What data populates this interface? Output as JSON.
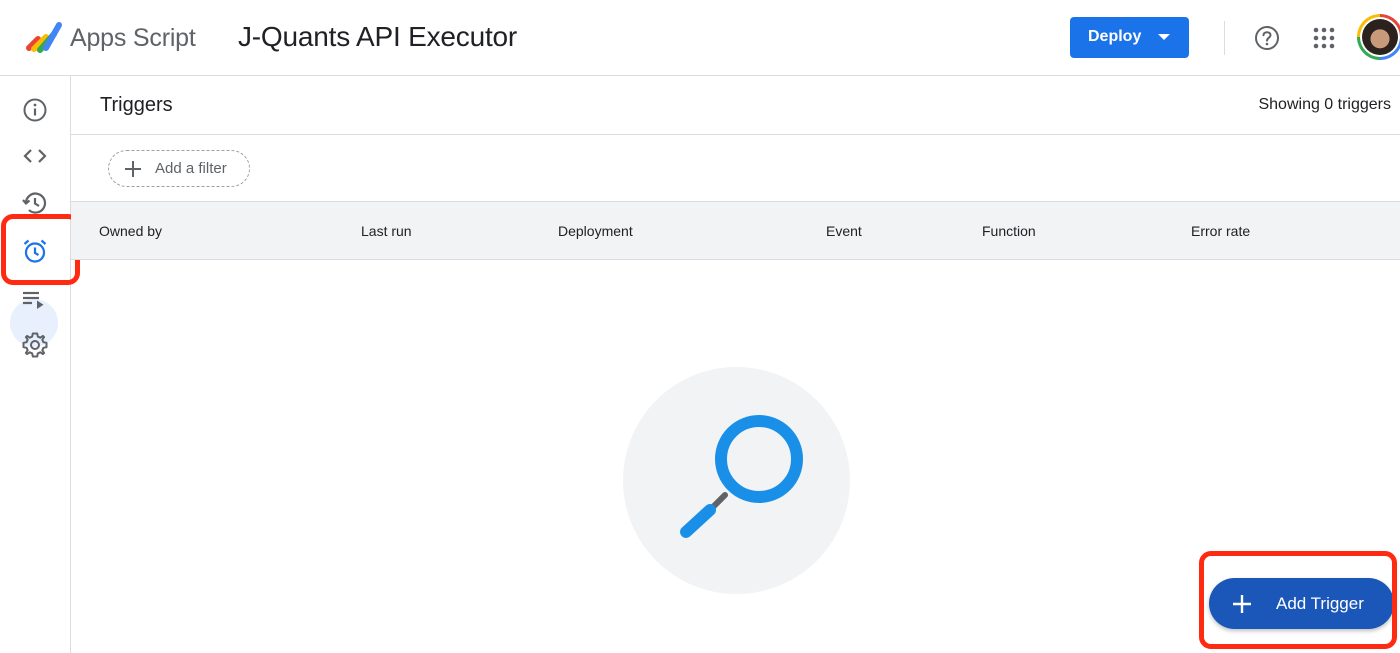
{
  "header": {
    "app_name": "Apps Script",
    "project_title": "J-Quants API Executor",
    "deploy_label": "Deploy",
    "help_icon": "help-icon",
    "apps_icon": "apps-grid-icon",
    "avatar": "avatar"
  },
  "rail": {
    "items": [
      {
        "icon": "info-icon",
        "label": "Overview"
      },
      {
        "icon": "code-icon",
        "label": "Editor"
      },
      {
        "icon": "history-icon",
        "label": "Project history"
      },
      {
        "icon": "alarm-icon",
        "label": "Triggers",
        "active": true
      },
      {
        "icon": "executions-icon",
        "label": "Executions"
      },
      {
        "icon": "gear-icon",
        "label": "Project Settings"
      }
    ]
  },
  "content": {
    "title": "Triggers",
    "count_text": "Showing 0 triggers",
    "filter_label": "Add a filter",
    "columns": [
      "Owned by",
      "Last run",
      "Deployment",
      "Event",
      "Function",
      "Error rate"
    ]
  },
  "fab": {
    "label": "Add Trigger"
  },
  "colors": {
    "primary": "#1a73e8",
    "fab": "#1a57b8",
    "highlight": "#ff2a12",
    "search_illustration": "#1a8fe8"
  }
}
